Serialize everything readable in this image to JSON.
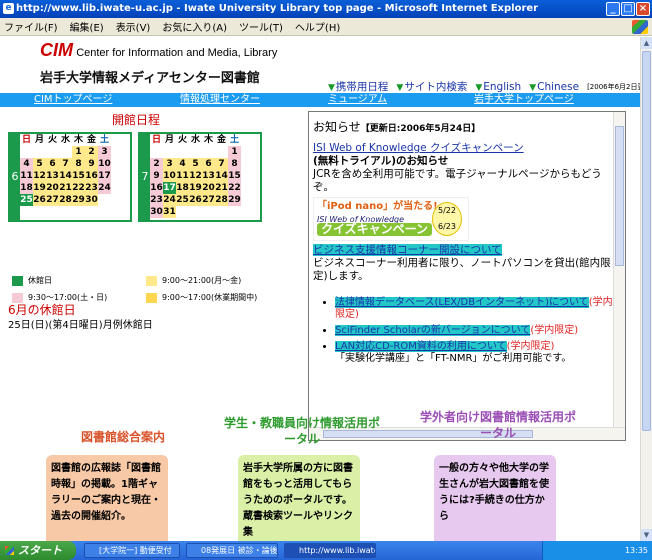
{
  "window": {
    "title": "http://www.lib.iwate-u.ac.jp - Iwate University Library top page - Microsoft Internet Explorer"
  },
  "menu": [
    "ファイル(F)",
    "編集(E)",
    "表示(V)",
    "お気に入り(A)",
    "ツール(T)",
    "ヘルプ(H)"
  ],
  "header": {
    "logo_mark": "CIM",
    "logo_sub": "Center for Information and Media, Library",
    "site_title": "岩手大学情報メディアセンター図書館",
    "top_links": [
      "携帯用日程",
      "サイト内検索",
      "English",
      "Chinese"
    ],
    "updated": "[2006年6月2日更新]"
  },
  "nav": [
    "CIMトップページ",
    "情報処理センター",
    "ミュージアム",
    "岩手大学トップページ"
  ],
  "calendar": {
    "heading": "開館日程",
    "june_month": "6",
    "july_month": "7",
    "weekdays": [
      "日",
      "月",
      "火",
      "水",
      "木",
      "金",
      "土"
    ],
    "june_cells": [
      "",
      "",
      "",
      "",
      "1",
      "2",
      "3",
      "4",
      "5",
      "6",
      "7",
      "8",
      "9",
      "10",
      "11",
      "12",
      "13",
      "14",
      "15",
      "16",
      "17",
      "18",
      "19",
      "20",
      "21",
      "22",
      "23",
      "24",
      "25",
      "26",
      "27",
      "28",
      "29",
      "30",
      ""
    ],
    "july_cells": [
      "",
      "",
      "",
      "",
      "",
      "",
      "1",
      "2",
      "3",
      "4",
      "5",
      "6",
      "7",
      "8",
      "9",
      "10",
      "11",
      "12",
      "13",
      "14",
      "15",
      "16",
      "17",
      "18",
      "19",
      "20",
      "21",
      "22",
      "23",
      "24",
      "25",
      "26",
      "27",
      "28",
      "29",
      "30",
      "31",
      "",
      "",
      "",
      "",
      "",
      ""
    ],
    "legend": [
      "休館日",
      "9:00～21:00(月～金)",
      "9:30～17:00(土・日)",
      "9:00～17:00(休業期間中)"
    ],
    "colors": {
      "closed": "#1a9a4a",
      "weekday": "#ffe98a",
      "weekend": "#f6cbd6",
      "vacation": "#ffe98a"
    }
  },
  "holiday": {
    "title": "6月の休館日",
    "note": "25日(日)(第4日曜日)月例休館日"
  },
  "news": {
    "heading": "お知らせ",
    "updated": "【更新日:2006年5月24日】",
    "item1_link": "ISI Web of Knowledge クイズキャンペーン",
    "item1_sub": "(無料トライアル)のお知らせ",
    "item1_text": "JCRを含め全利用可能です。電子ジャーナルページからもどうぞ。",
    "promo_line1": "「iPod nano」が当たる!",
    "promo_line2": "ISI Web of Knowledge",
    "promo_line3": "クイズキャンペーン",
    "promo_badge_top": "5/22",
    "promo_badge_bottom": "6/23",
    "item2_link": "ビジネス支援情報コーナー開設について",
    "item2_text": "ビジネスコーナー利用者に限り、ノートパソコンを貸出(館内限定)します。",
    "bullet1_link": "法律情報データベース(LEX/DBインターネット)について",
    "bullet1_tag": "(学内限定)",
    "bullet2_link": "SciFinder Scholarの新バージョンについて",
    "bullet2_tag": "(学内限定)",
    "bullet3_link": "LAN対応CD-ROM資料の利用について",
    "bullet3_tag": "(学内限定)",
    "bullet3_text": "「実験化学講座」と「FT-NMR」がご利用可能です。"
  },
  "panels": {
    "general_title": "図書館総合案内",
    "general_text": "図書館の広報誌「図書館時報」の掲載。1階ギャラリーのご案内と現在・過去の開催紹介。",
    "students_title": "学生・教職員向け情報活用ポータル",
    "students_text": "岩手大学所属の方に図書館をもっと活用してもらうためのポータルです。蔵書検索ツールやリンク集",
    "outside_title": "学外者向け図書館情報活用ポータル",
    "outside_text": "一般の方々や他大学の学生さんが岩大図書館を使うには?手続きの仕方から"
  },
  "taskbar": {
    "start": "スタート",
    "tasks": [
      "[大学院一] 動便受付",
      "08発展日 被診・論後...",
      "http://www.lib.iwate-..."
    ],
    "clock": "13:35"
  }
}
